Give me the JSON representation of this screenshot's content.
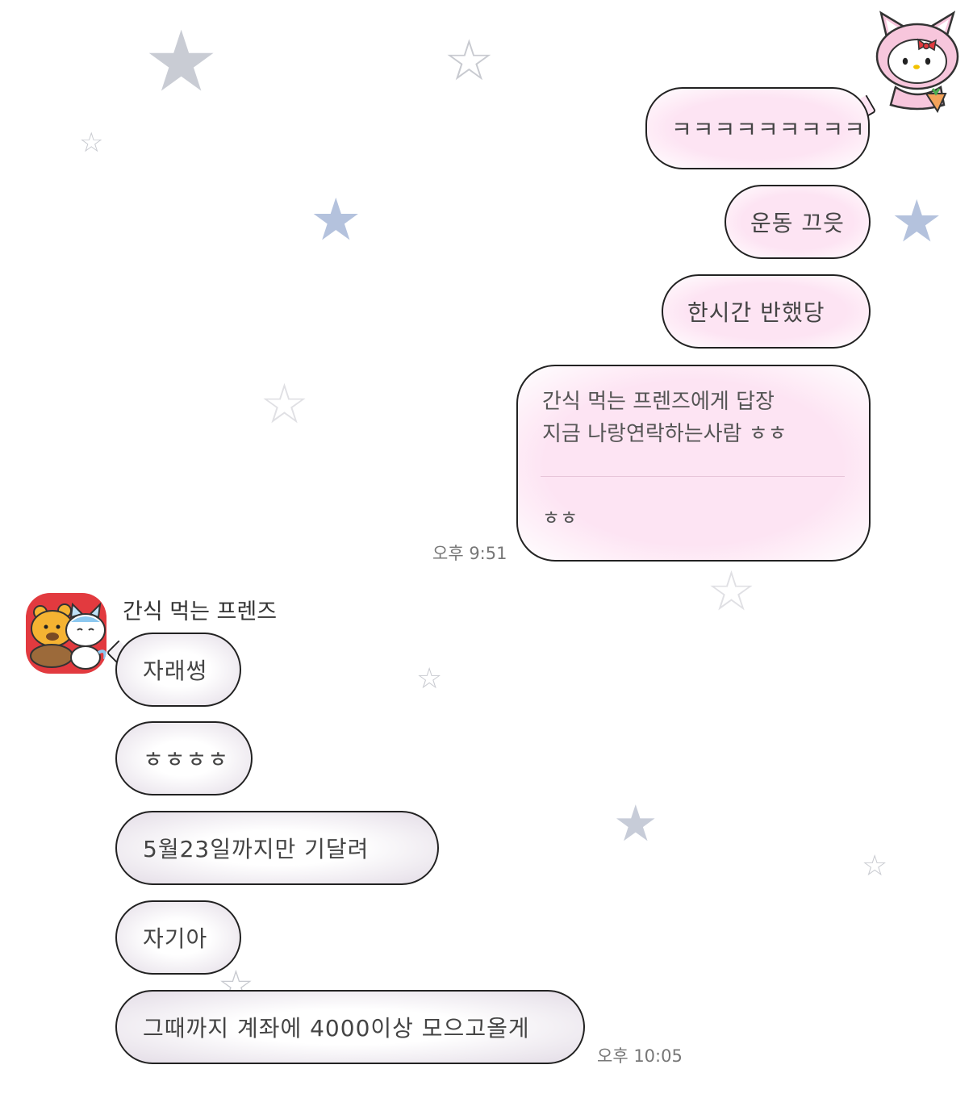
{
  "decor": {
    "star_filled": "★",
    "star_outline": "☆",
    "colors": {
      "bubble_me": "#fde4f3",
      "bubble_them": "#e3dce6",
      "border": "#222222"
    }
  },
  "me": {
    "avatar_icon": "hello-kitty-bunny-icon",
    "messages": [
      "ㅋㅋㅋㅋㅋㅋㅋㅋㅋ",
      "운동 끄읏",
      "한시간 반했당"
    ],
    "reply": {
      "header_line1": "간식 먹는 프렌즈에게 답장",
      "header_line2": "지금 나랑연락하는사람 ㅎㅎ",
      "body": "ㅎㅎ"
    },
    "time": "오후 9:51"
  },
  "them": {
    "avatar_icon": "bear-and-cat-friends-icon",
    "name": "간식 먹는 프렌즈",
    "messages": [
      "자래썽",
      "ㅎㅎㅎㅎ",
      "5월23일까지만 기달려",
      "자기아",
      "그때까지 계좌에 4000이상 모으고올게"
    ],
    "time": "오후 10:05"
  }
}
